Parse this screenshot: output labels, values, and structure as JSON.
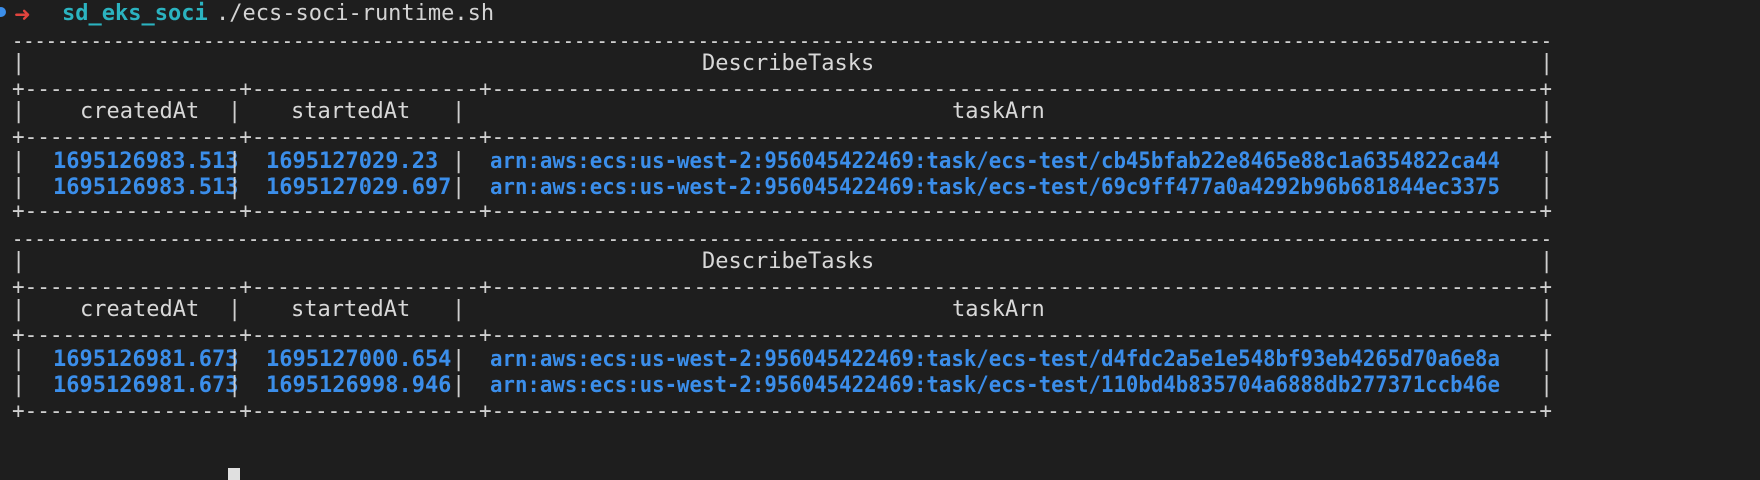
{
  "prompt": {
    "arrow": "➜",
    "directory": "sd_eks_soci",
    "command": "./ecs-soci-runtime.sh"
  },
  "colors": {
    "background": "#1e1e1e",
    "text": "#d4d4d4",
    "accent_blue": "#3b8eea",
    "prompt_arrow": "#e0443e",
    "prompt_dir": "#2bb3c0"
  },
  "tables": [
    {
      "title": "DescribeTasks",
      "headers": [
        "createdAt",
        "startedAt",
        "taskArn"
      ],
      "rows": [
        [
          "1695126983.513",
          "1695127029.23",
          "arn:aws:ecs:us-west-2:956045422469:task/ecs-test/cb45bfab22e8465e88c1a6354822ca44"
        ],
        [
          "1695126983.513",
          "1695127029.697",
          "arn:aws:ecs:us-west-2:956045422469:task/ecs-test/69c9ff477a0a4292b96b681844ec3375"
        ]
      ]
    },
    {
      "title": "DescribeTasks",
      "headers": [
        "createdAt",
        "startedAt",
        "taskArn"
      ],
      "rows": [
        [
          "1695126981.673",
          "1695127000.654",
          "arn:aws:ecs:us-west-2:956045422469:task/ecs-test/d4fdc2a5e1e548bf93eb4265d70a6e8a"
        ],
        [
          "1695126981.673",
          "1695126998.946",
          "arn:aws:ecs:us-west-2:956045422469:task/ecs-test/110bd4b835704a6888db277371ccb46e"
        ]
      ]
    }
  ]
}
